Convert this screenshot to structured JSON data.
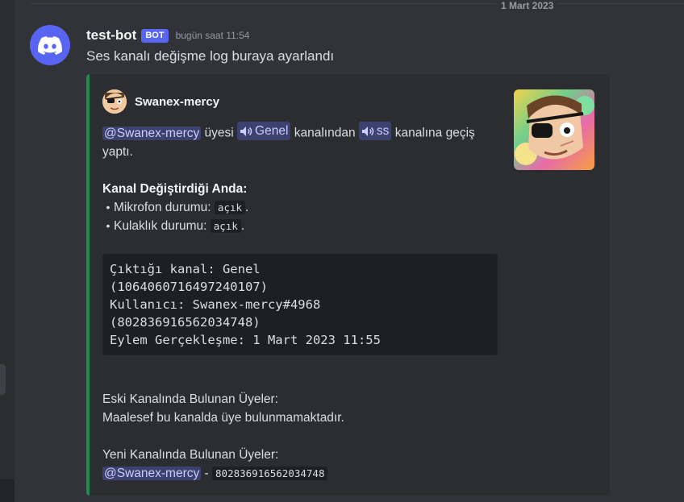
{
  "date_divider": "1 Mart 2023",
  "message": {
    "author": "test-bot",
    "bot_tag": "BOT",
    "timestamp": "bugün saat 11:54",
    "text": "Ses kanalı değişme log buraya ayarlandı",
    "avatar_icon": "discord-logo-icon",
    "avatar_color": "#5865f2"
  },
  "embed": {
    "accent_color": "#1f8b4c",
    "author_name": "Swanex-mercy",
    "description": {
      "mention": "@Swanex-mercy",
      "text1": " üyesi ",
      "channel_from": "Genel",
      "text2": " kanalından ",
      "channel_to": "ss",
      "text3": " kanalına geçiş yaptı."
    },
    "state_title": "Kanal Değiştirdiği Anda:",
    "mic_label": "Mikrofon durumu:",
    "mic_value": "açık",
    "headset_label": "Kulaklık durumu:",
    "headset_value": "açık",
    "code_lines": [
      "Çıktığı kanal: Genel",
      "(1064060716497240107)",
      "Kullanıcı: Swanex-mercy#4968",
      "(802836916562034748)",
      "Eylem Gerçekleşme: 1 Mart 2023 11:55"
    ],
    "old_members_title": "Eski Kanalında Bulunan Üyeler:",
    "old_members_text": "Maalesef bu kanalda üye bulunmamaktadır.",
    "new_members_title": "Yeni Kanalında Bulunan Üyeler:",
    "new_member_mention": "@Swanex-mercy",
    "new_member_separator": " - ",
    "new_member_id": "802836916562034748"
  }
}
